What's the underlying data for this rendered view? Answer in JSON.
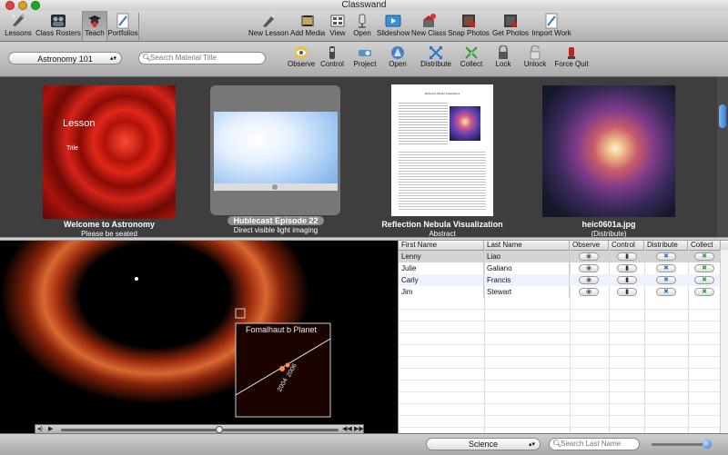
{
  "window": {
    "title": "Classwand"
  },
  "toolbar": {
    "left": [
      {
        "label": "Lessons",
        "icon": "lessons-icon"
      },
      {
        "label": "Class Rosters",
        "icon": "class-rosters-icon"
      },
      {
        "label": "Teach",
        "icon": "teach-icon",
        "selected": true
      },
      {
        "label": "Portfolios",
        "icon": "portfolios-icon"
      }
    ],
    "right": [
      {
        "label": "New Lesson",
        "icon": "new-lesson-icon"
      },
      {
        "label": "Add Media",
        "icon": "add-media-icon"
      },
      {
        "label": "View",
        "icon": "view-icon"
      },
      {
        "label": "Open",
        "icon": "open-icon"
      },
      {
        "label": "Slideshow",
        "icon": "slideshow-icon"
      },
      {
        "label": "New Class",
        "icon": "new-class-icon"
      },
      {
        "label": "Snap Photos",
        "icon": "snap-photos-icon"
      },
      {
        "label": "Get Photos",
        "icon": "get-photos-icon"
      },
      {
        "label": "Import Work",
        "icon": "import-work-icon"
      }
    ]
  },
  "subbar": {
    "class_select": "Astronomy 101",
    "search_placeholder": "Search Material Title",
    "actions": [
      {
        "label": "Observe",
        "icon": "observe-icon"
      },
      {
        "label": "Control",
        "icon": "control-icon"
      },
      {
        "label": "Project",
        "icon": "project-icon"
      },
      {
        "label": "Open",
        "icon": "open-icon"
      },
      {
        "label": "Distribute",
        "icon": "distribute-icon"
      },
      {
        "label": "Collect",
        "icon": "collect-icon"
      },
      {
        "label": "Lock",
        "icon": "lock-icon"
      },
      {
        "label": "Unlock",
        "icon": "unlock-icon"
      },
      {
        "label": "Force Quit",
        "icon": "force-quit-icon"
      }
    ]
  },
  "gallery": {
    "items": [
      {
        "title": "Welcome to Astronomy",
        "subtitle": "Please be seated",
        "slide_heading": "Lesson",
        "slide_sub": "Title"
      },
      {
        "title": "Hublecast Episode 22",
        "subtitle": "Direct visible light imaging"
      },
      {
        "title": "Reflection Nebula Visualization",
        "subtitle": "Abstract",
        "doc_title": "Reflection Nebula Visualization"
      },
      {
        "title": "heic0601a.jpg",
        "subtitle": "(Distribute)"
      }
    ]
  },
  "viewer": {
    "inset_label": "Fomalhaut b Planet",
    "year_labels": [
      "2006",
      "2004"
    ]
  },
  "students": {
    "columns": [
      "First Name",
      "Last Name",
      "Observe",
      "Control",
      "Distribute",
      "Collect"
    ],
    "rows": [
      {
        "first": "Lenny",
        "last": "Liao"
      },
      {
        "first": "Julie",
        "last": "Galiano"
      },
      {
        "first": "Carly",
        "last": "Francis"
      },
      {
        "first": "Jim",
        "last": "Stewart"
      }
    ]
  },
  "bottombar": {
    "subject_select": "Science",
    "lastname_placeholder": "Search Last Name"
  },
  "colors": {
    "accent": "#3b7fd8",
    "selection": "#d4d4d4",
    "alt_row": "#edf3fe"
  }
}
